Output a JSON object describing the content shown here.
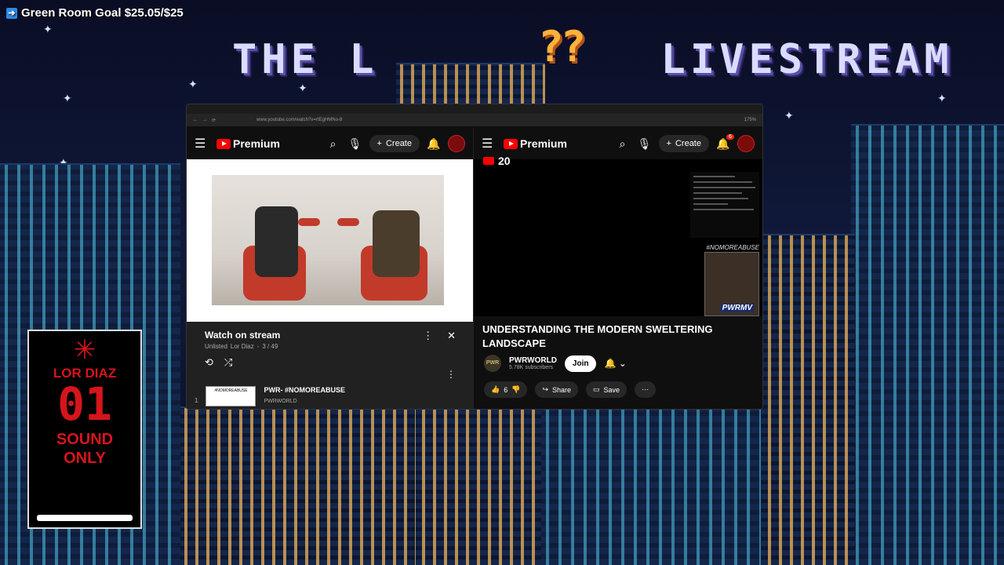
{
  "overlay": {
    "goal_text": "Green Room Goal $25.05/$25",
    "goal_icon": "arrow-right-icon",
    "banner_left": "THE L",
    "banner_right": "LIVESTREAM",
    "badge_text": "??"
  },
  "card": {
    "icon": "cannabis-leaf-icon",
    "name": "LOR DIAZ",
    "number": "01",
    "sound": "SOUND",
    "only": "ONLY",
    "accent": "#d5151b"
  },
  "browser": {
    "url": "www.youtube.com/watch?v=rtEgHMNo-8",
    "zoom": "175%"
  },
  "left_pane": {
    "brand": "Premium",
    "create_label": "Create",
    "playlist": {
      "title": "Watch on stream",
      "visibility": "Unlisted",
      "owner": "Lor Diaz",
      "position": "3 / 49",
      "item_index": "1",
      "item_title": "PWR- #NOMOREABUSE",
      "item_channel": "PWRWORLD",
      "item_thumb_text": "#NOMOREABUSE"
    }
  },
  "right_pane": {
    "brand": "Premium",
    "create_label": "Create",
    "notif_count": "6",
    "viewer_count": "20",
    "cam_hashtag": "#NOMOREABUSE",
    "cam_tag": "PWRMV",
    "title": "UNDERSTANDING THE MODERN SWELTERING LANDSCAPE",
    "channel_name": "PWRWORLD",
    "subscribers": "5.78K subscribers",
    "join_label": "Join",
    "likes": "6",
    "share_label": "Share",
    "save_label": "Save"
  },
  "colors": {
    "youtube_red": "#ff0000",
    "dark_bg": "#0f0f0f"
  }
}
